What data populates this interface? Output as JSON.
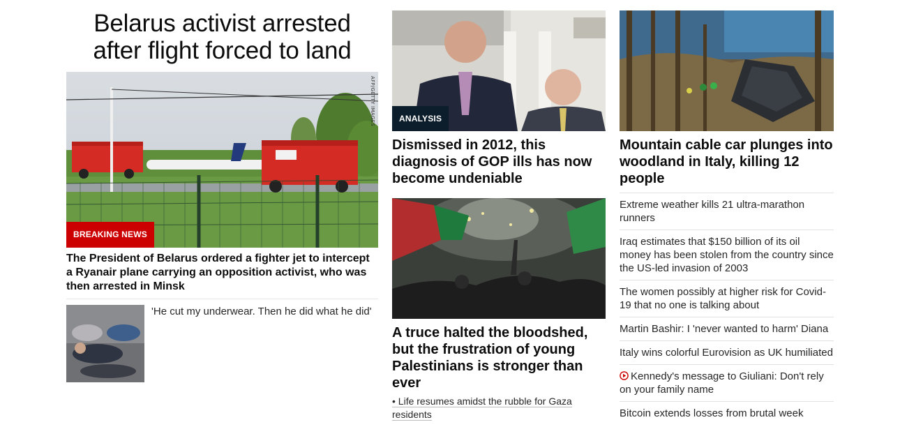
{
  "lead": {
    "banner_headline": "Belarus activist arrested after flight forced to land",
    "image_label": "BREAKING NEWS",
    "image_credit": "AFP/GETTY IMAGES",
    "summary": "The President of Belarus ordered a fighter jet to intercept a Ryanair plane carrying an opposition activist, who was then arrested in Minsk",
    "sub_story": "'He cut my underwear. Then he did what he did'"
  },
  "middle": {
    "card1": {
      "image_label": "ANALYSIS",
      "headline": "Dismissed in 2012, this diagnosis of GOP ills has now become undeniable"
    },
    "card2": {
      "headline": "A truce halted the bloodshed, but the frustration of young Palestinians is stronger than ever",
      "related": "• Life resumes amidst the rubble for Gaza residents"
    }
  },
  "right": {
    "headline": "Mountain cable car plunges into woodland in Italy, killing 12 people",
    "list": [
      {
        "text": "Extreme weather kills 21 ultra-marathon runners",
        "video": false
      },
      {
        "text": "Iraq estimates that $150 billion of its oil money has been stolen from the country since the US-led invasion of 2003",
        "video": false
      },
      {
        "text": "The women possibly at higher risk for Covid-19 that no one is talking about",
        "video": false
      },
      {
        "text": "Martin Bashir: I 'never wanted to harm' Diana",
        "video": false
      },
      {
        "text": "Italy wins colorful Eurovision as UK humiliated",
        "video": false
      },
      {
        "text": "Kennedy's message to Giuliani: Don't rely on your family name",
        "video": true
      },
      {
        "text": "Bitcoin extends losses from brutal week",
        "video": false
      }
    ]
  },
  "colors": {
    "breaking_red": "#cc0000",
    "analysis_navy": "#0c1e2c",
    "play_icon_red": "#cc0000"
  }
}
